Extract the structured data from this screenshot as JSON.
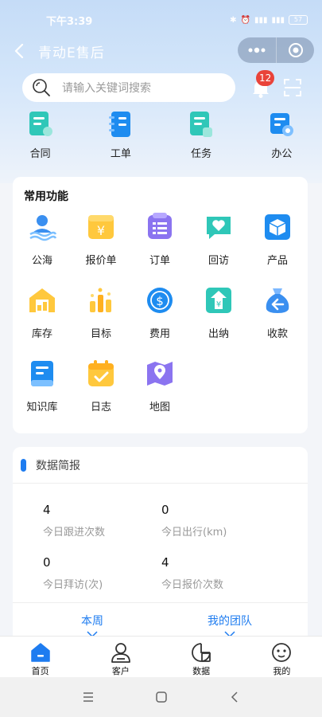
{
  "status_bar": {
    "time": "下午3:39",
    "battery": "57"
  },
  "nav": {
    "title": "青动E售后"
  },
  "search": {
    "placeholder": "请输入关键词搜索"
  },
  "notifications": {
    "count": "12"
  },
  "quick_actions": [
    {
      "label": "合同",
      "icon": "contract-icon"
    },
    {
      "label": "工单",
      "icon": "work-order-icon"
    },
    {
      "label": "任务",
      "icon": "task-icon"
    },
    {
      "label": "办公",
      "icon": "office-icon"
    }
  ],
  "functions": {
    "title": "常用功能",
    "items": [
      {
        "label": "公海",
        "icon": "public-pool-icon"
      },
      {
        "label": "报价单",
        "icon": "quotation-icon"
      },
      {
        "label": "订单",
        "icon": "order-icon"
      },
      {
        "label": "回访",
        "icon": "revisit-icon"
      },
      {
        "label": "产品",
        "icon": "product-icon"
      },
      {
        "label": "库存",
        "icon": "inventory-icon"
      },
      {
        "label": "目标",
        "icon": "target-icon"
      },
      {
        "label": "费用",
        "icon": "expense-icon"
      },
      {
        "label": "出纳",
        "icon": "cashier-icon"
      },
      {
        "label": "收款",
        "icon": "collection-icon"
      },
      {
        "label": "知识库",
        "icon": "knowledge-base-icon"
      },
      {
        "label": "日志",
        "icon": "log-icon"
      },
      {
        "label": "地图",
        "icon": "map-icon"
      }
    ]
  },
  "report": {
    "title": "数据简报",
    "stats": [
      {
        "value": "4",
        "label": "今日跟进次数"
      },
      {
        "value": "0",
        "label": "今日出行(km)"
      },
      {
        "value": "0",
        "label": "今日拜访(次)"
      },
      {
        "value": "4",
        "label": "今日报价次数"
      }
    ],
    "period_tab": "本周",
    "scope_tab": "我的团队"
  },
  "tabbar": [
    {
      "label": "首页",
      "icon": "home-icon",
      "active": true
    },
    {
      "label": "客户",
      "icon": "customer-icon",
      "active": false
    },
    {
      "label": "数据",
      "icon": "data-icon",
      "active": false
    },
    {
      "label": "我的",
      "icon": "profile-icon",
      "active": false
    }
  ],
  "colors": {
    "accent": "#1e7cf0",
    "badge": "#e9433a",
    "header_bg": "#c5dcf7"
  }
}
